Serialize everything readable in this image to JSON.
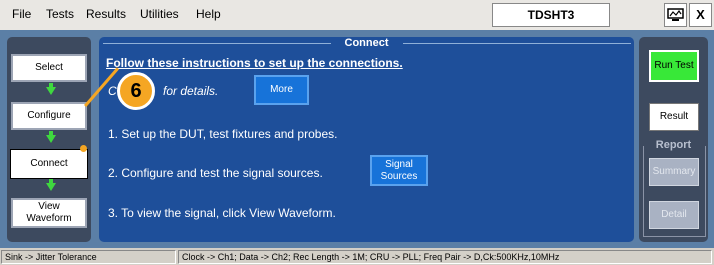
{
  "menu": {
    "items": [
      "File",
      "Tests",
      "Results",
      "Utilities",
      "Help"
    ],
    "app_title": "TDSHT3",
    "close_symbol": "X",
    "monitor_icon": "monitor-icon"
  },
  "steps": {
    "select": "Select",
    "configure": "Configure",
    "connect": "Connect",
    "view_waveform": "View Waveform",
    "active": "Connect"
  },
  "connect_panel": {
    "title": "Connect",
    "heading": "Follow these instructions to set up the connections.",
    "line_click_prefix": "C",
    "line_click_suffix": "for details.",
    "more_button": "More",
    "instruction_1": "1. Set up the DUT, test fixtures and probes.",
    "instruction_2": "2. Configure and test the signal sources.",
    "signal_sources_button": "Signal Sources",
    "instruction_3": "3. To view the signal, click View Waveform."
  },
  "callout": {
    "number": "6",
    "color": "#f5a623"
  },
  "right_panel": {
    "run_test": "Run Test",
    "result": "Result",
    "report_label": "Report",
    "summary": "Summary",
    "detail": "Detail"
  },
  "status": {
    "left": "Sink -> Jitter Tolerance",
    "right": "Clock -> Ch1; Data -> Ch2; Rec Length -> 1M; CRU -> PLL; Freq Pair -> D,Ck:500KHz,10MHz"
  },
  "colors": {
    "accent_green": "#38e838",
    "panel_blue": "#1e4f9a",
    "button_blue": "#1773d9"
  }
}
